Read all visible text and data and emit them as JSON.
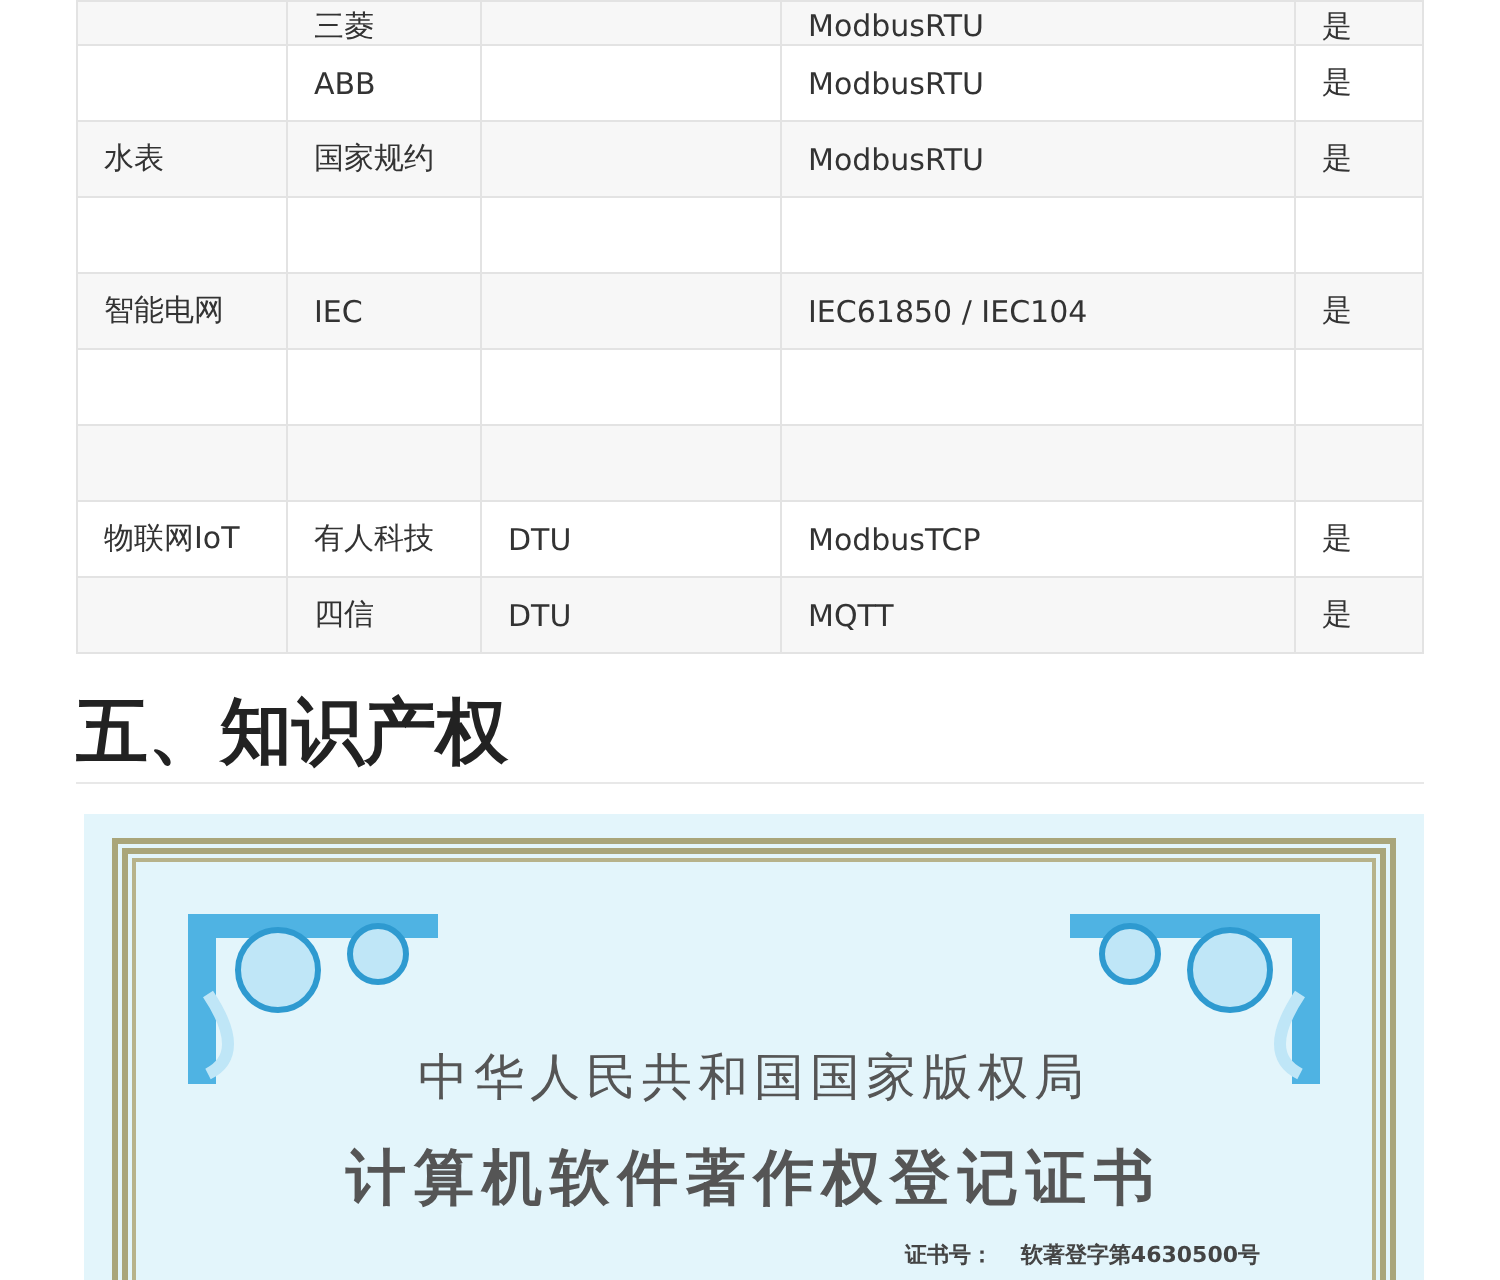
{
  "table": {
    "rows": [
      {
        "cells": [
          "",
          "三菱",
          "",
          "ModbusRTU",
          "是"
        ]
      },
      {
        "cells": [
          "",
          "ABB",
          "",
          "ModbusRTU",
          "是"
        ]
      },
      {
        "cells": [
          "水表",
          "国家规约",
          "",
          "ModbusRTU",
          "是"
        ]
      },
      {
        "cells": [
          "",
          "",
          "",
          "",
          ""
        ]
      },
      {
        "cells": [
          "智能电网",
          "IEC",
          "",
          "IEC61850 / IEC104",
          "是"
        ]
      },
      {
        "cells": [
          "",
          "",
          "",
          "",
          ""
        ]
      },
      {
        "cells": [
          "",
          "",
          "",
          "",
          ""
        ]
      },
      {
        "cells": [
          "物联网IoT",
          "有人科技",
          "DTU",
          "ModbusTCP",
          "是"
        ]
      },
      {
        "cells": [
          "",
          "四信",
          "DTU",
          "MQTT",
          "是"
        ]
      }
    ]
  },
  "section_heading": "五、知识产权",
  "certificate": {
    "issuer": "中华人民共和国国家版权局",
    "title": "计算机软件著作权登记证书",
    "number_label": "证书号：",
    "number": "软著登字第4630500号"
  }
}
